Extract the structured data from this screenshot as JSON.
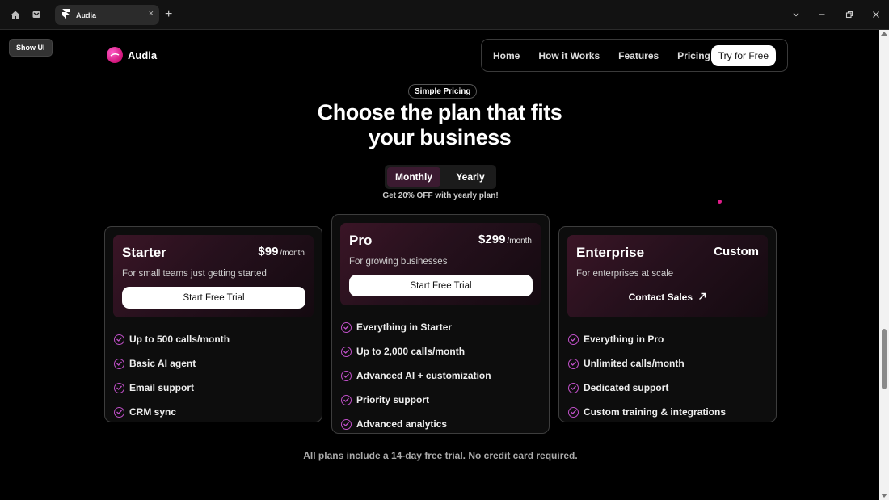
{
  "browser": {
    "tab_title": "Audia",
    "tab_close": "×",
    "new_tab": "+"
  },
  "show_ui": "Show UI",
  "brand": {
    "name": "Audia"
  },
  "nav": {
    "links": [
      "Home",
      "How it Works",
      "Features",
      "Pricing"
    ],
    "cta": "Try for Free"
  },
  "hero": {
    "badge": "Simple Pricing",
    "headline_line1": "Choose the plan that fits",
    "headline_line2": "your business"
  },
  "billing": {
    "options": [
      "Monthly",
      "Yearly"
    ],
    "selected": "Monthly",
    "promo": "Get 20% OFF with yearly plan!"
  },
  "plans": [
    {
      "name": "Starter",
      "price": "$99",
      "per": "/month",
      "description": "For small teams just getting started",
      "button": "Start Free Trial",
      "features": [
        "Up to 500 calls/month",
        "Basic AI agent",
        "Email support",
        "CRM sync"
      ]
    },
    {
      "name": "Pro",
      "price": "$299",
      "per": "/month",
      "description": "For growing businesses",
      "button": "Start Free Trial",
      "features": [
        "Everything in Starter",
        "Up to 2,000 calls/month",
        "Advanced AI + customization",
        "Priority support",
        "Advanced analytics"
      ]
    },
    {
      "name": "Enterprise",
      "price": "Custom",
      "description": "For enterprises at scale",
      "button": "Contact Sales",
      "features": [
        "Everything in Pro",
        "Unlimited calls/month",
        "Dedicated support",
        "Custom training & integrations"
      ]
    }
  ],
  "footnote": "All plans include a 14-day free trial. No credit card required.",
  "colors": {
    "accent": "#c050c8",
    "brand": "#e01c8a",
    "toggle_active": "#3b1a30"
  }
}
